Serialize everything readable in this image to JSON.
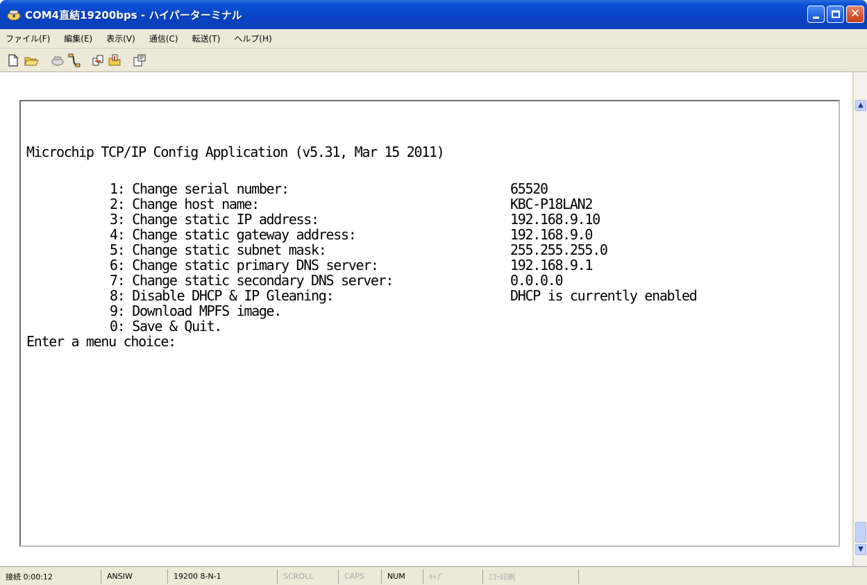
{
  "window": {
    "title": "COM4直結19200bps - ハイパーターミナル",
    "title_icon": "hyperterminal-phone-icon",
    "controls": [
      "minimize",
      "maximize",
      "close"
    ]
  },
  "menu": {
    "items": [
      "ファイル(F)",
      "編集(E)",
      "表示(V)",
      "通信(C)",
      "転送(T)",
      "ヘルプ(H)"
    ]
  },
  "toolbar": {
    "icons": [
      "new-icon",
      "open-icon",
      "connect-icon",
      "disconnect-icon",
      "send-icon",
      "receive-icon",
      "properties-icon"
    ]
  },
  "terminal": {
    "header": "Microchip TCP/IP Config Application (v5.31, Mar 15 2011)",
    "menu_items": [
      {
        "label": "1: Change serial number:",
        "value": "65520"
      },
      {
        "label": "2: Change host name:",
        "value": "KBC-P18LAN2"
      },
      {
        "label": "3: Change static IP address:",
        "value": "192.168.9.10"
      },
      {
        "label": "4: Change static gateway address:",
        "value": "192.168.9.0"
      },
      {
        "label": "5: Change static subnet mask:",
        "value": "255.255.255.0"
      },
      {
        "label": "6: Change static primary DNS server:",
        "value": "192.168.9.1"
      },
      {
        "label": "7: Change static secondary DNS server:",
        "value": "0.0.0.0"
      },
      {
        "label": "8: Disable DHCP & IP Gleaning:",
        "value": "DHCP is currently enabled"
      },
      {
        "label": "9: Download MPFS image.",
        "value": ""
      },
      {
        "label": "0: Save & Quit.",
        "value": ""
      }
    ],
    "prompt": "Enter a menu choice:"
  },
  "status": {
    "connected_time": "接続 0:00:12",
    "emulation": "ANSIW",
    "port_settings": "19200 8-N-1",
    "scroll": "SCROLL",
    "caps": "CAPS",
    "num": "NUM",
    "capture": "ｷｬﾌﾟ",
    "echo": "ｴｺｰ印刷"
  }
}
